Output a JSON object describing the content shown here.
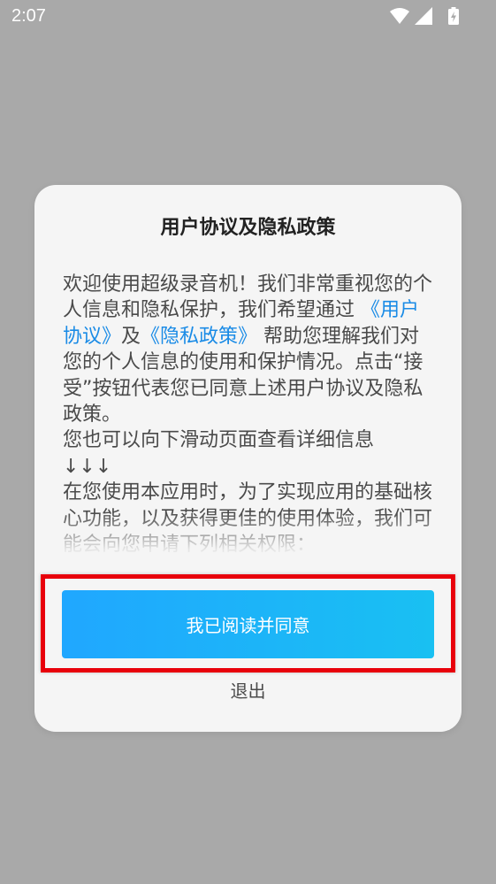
{
  "status_bar": {
    "time": "2:07",
    "icons": [
      "wifi-icon",
      "signal-icon",
      "battery-charging-icon"
    ]
  },
  "dialog": {
    "title": "用户协议及隐私政策",
    "body": {
      "intro_1": "欢迎使用超级录音机！我们非常重视您的个人信息和隐私保护，我们希望通过",
      "user_agreement_link": "《用户协议》",
      "and": "及",
      "privacy_policy_link": "《隐私政策》",
      "intro_2": "帮助您理解我们对您的个人信息的使用和保护情况。点击“接受”按钮代表您已同意上述用户协议及隐私政策。",
      "scroll_hint": "您也可以向下滑动页面查看详细信息",
      "arrows": "↓↓↓",
      "permissions_intro": "在您使用本应用时，为了实现应用的基础核心功能，以及获得更佳的使用体验，我们可能会向您申请下列相关权限："
    },
    "agree_label": "我已阅读并同意",
    "exit_label": "退出"
  },
  "colors": {
    "backdrop": "#a9a9a9",
    "link": "#1a8be6",
    "button_start": "#20a7ff",
    "button_end": "#19c0f2",
    "highlight": "#e8000b"
  }
}
